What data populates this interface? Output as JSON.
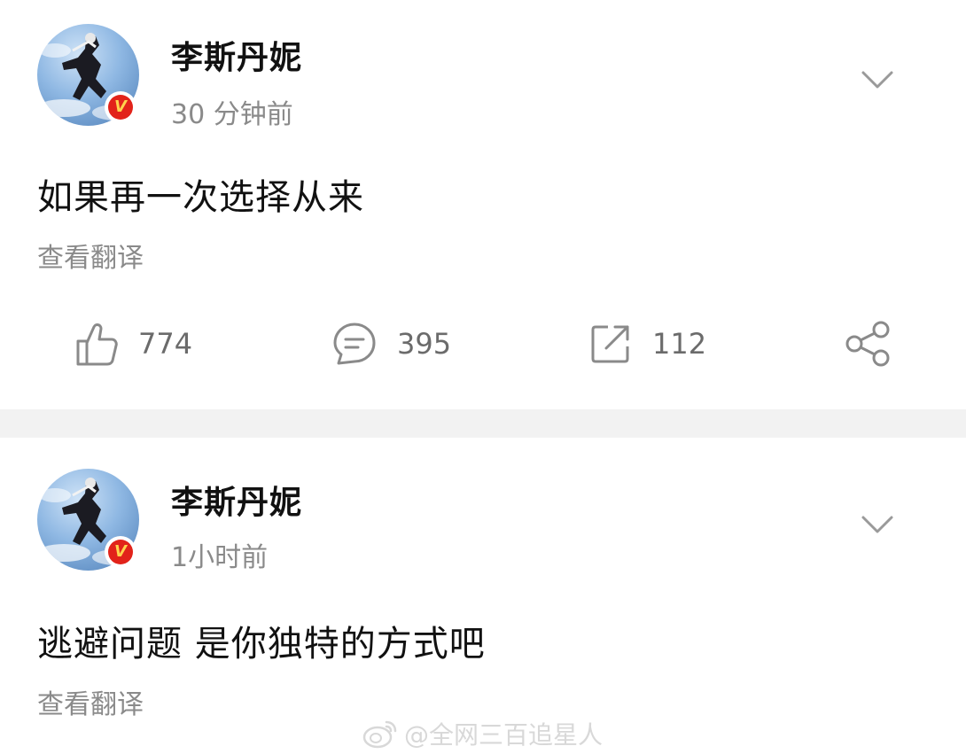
{
  "posts": [
    {
      "username": "李斯丹妮",
      "timestamp": "30 分钟前",
      "content": "如果再一次选择从来",
      "translate_label": "查看翻译",
      "actions": {
        "likes": "774",
        "comments": "395",
        "reposts": "112"
      },
      "verified_badge": "V"
    },
    {
      "username": "李斯丹妮",
      "timestamp": "1小时前",
      "content": "逃避问题 是你独特的方式吧",
      "translate_label": "查看翻译",
      "verified_badge": "V"
    }
  ],
  "watermark": {
    "text": "@全网三百追星人",
    "icon": "weibo-logo-icon"
  },
  "icons": {
    "like": "thumbs-up-icon",
    "comment": "comment-icon",
    "repost": "repost-icon",
    "share": "share-icon",
    "menu": "chevron-down-icon"
  },
  "colors": {
    "badge": "#e2231a",
    "badge_text": "#ffd34d",
    "secondary_text": "#8a8a8a",
    "separator": "#f2f2f2"
  }
}
